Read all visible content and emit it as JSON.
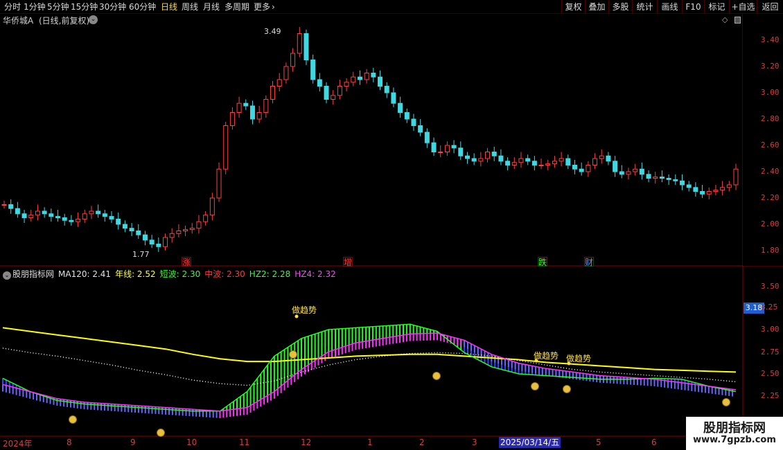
{
  "toolbar": {
    "periods": [
      "分时",
      "1分钟",
      "5分钟",
      "15分钟",
      "30分钟",
      "60分钟",
      "日线",
      "周线",
      "月线",
      "多周期",
      "更多"
    ],
    "active_period": "日线",
    "more_icon": "chevron-right-icon",
    "buttons": [
      "复权",
      "叠加",
      "多股",
      "统计",
      "画线",
      "F10",
      "标记",
      "+自选",
      "返回"
    ]
  },
  "stock": {
    "name": "华侨城A",
    "mode": "(日线,前复权)",
    "collapse_icon": "chevron-down-icon",
    "high_label": "3.49",
    "low_label": "1.77",
    "price_axis": [
      "3.40",
      "3.20",
      "3.00",
      "2.80",
      "2.60",
      "2.40",
      "2.20",
      "2.00",
      "1.80"
    ],
    "signal_labels": [
      {
        "text": "涨",
        "color": "#ff3b3b"
      },
      {
        "text": "增",
        "color": "#ff3b3b"
      },
      {
        "text": "跌",
        "color": "#33ff33"
      },
      {
        "text": "财",
        "color": "#3aa0ff"
      }
    ]
  },
  "indicator": {
    "name": "股朋指标网",
    "values": [
      {
        "label": "MA120: 2.41",
        "color": "#e0e0e0"
      },
      {
        "label": "年线: 2.52",
        "color": "#ffff33"
      },
      {
        "label": "短波: 2.30",
        "color": "#33ff33"
      },
      {
        "label": "中波: 2.30",
        "color": "#ff3b3b"
      },
      {
        "label": "HZ2: 2.28",
        "color": "#33ff33"
      },
      {
        "label": "HZ4: 2.32",
        "color": "#ff44ff"
      }
    ],
    "axis": [
      "3.50",
      "3.25",
      "3.00",
      "2.75",
      "2.50",
      "2.25"
    ],
    "current_value": "3.18",
    "annotations": [
      "做趋势",
      "做趋势",
      "做趋势"
    ],
    "colors": {
      "yearline": "#ffff00",
      "ma120": "#ffffff",
      "short_up": "#22ff22",
      "mid_up": "#ff33ff",
      "short_down": "#3344ff",
      "mid_down": "#cc44ff"
    }
  },
  "dates": {
    "labels": [
      "2024年",
      "8",
      "9",
      "10",
      "11",
      "12",
      "1",
      "2",
      "3",
      "5",
      "6"
    ],
    "selected": "2025/03/14/五"
  },
  "watermark": {
    "title": "股朋指标网",
    "url": "www.7gpzb.com"
  },
  "chart_data": {
    "type": "candlestick",
    "title": "华侨城A (日线,前复权)",
    "ylim": [
      1.72,
      3.55
    ],
    "price_ticks": [
      3.4,
      3.2,
      3.0,
      2.8,
      2.6,
      2.4,
      2.2,
      2.0,
      1.8
    ],
    "high": 3.49,
    "low": 1.77,
    "close_series": [
      2.15,
      2.12,
      2.08,
      2.05,
      2.07,
      2.1,
      2.08,
      2.06,
      2.05,
      2.03,
      2.02,
      2.04,
      2.08,
      2.1,
      2.08,
      2.06,
      2.04,
      2.0,
      1.97,
      1.95,
      1.92,
      1.88,
      1.85,
      1.83,
      1.9,
      1.93,
      1.95,
      1.96,
      1.97,
      2.02,
      2.07,
      2.2,
      2.42,
      2.75,
      2.85,
      2.92,
      2.9,
      2.8,
      2.85,
      2.95,
      3.05,
      3.1,
      3.2,
      3.3,
      3.45,
      3.25,
      3.1,
      3.05,
      2.95,
      2.98,
      3.05,
      3.08,
      3.12,
      3.1,
      3.15,
      3.12,
      3.05,
      3.0,
      2.92,
      2.85,
      2.8,
      2.75,
      2.7,
      2.62,
      2.55,
      2.55,
      2.6,
      2.58,
      2.52,
      2.5,
      2.48,
      2.5,
      2.55,
      2.52,
      2.48,
      2.45,
      2.47,
      2.5,
      2.48,
      2.45,
      2.45,
      2.46,
      2.48,
      2.5,
      2.45,
      2.42,
      2.4,
      2.45,
      2.5,
      2.52,
      2.48,
      2.4,
      2.38,
      2.4,
      2.42,
      2.38,
      2.35,
      2.36,
      2.35,
      2.34,
      2.33,
      2.3,
      2.28,
      2.25,
      2.23,
      2.25,
      2.26,
      2.28,
      2.3,
      2.42
    ],
    "indicator_series": {
      "year_line": [
        3.02,
        2.98,
        2.94,
        2.9,
        2.86,
        2.82,
        2.78,
        2.72,
        2.67,
        2.64,
        2.64,
        2.66,
        2.68,
        2.7,
        2.71,
        2.72,
        2.72,
        2.7,
        2.68,
        2.66,
        2.63,
        2.61,
        2.59,
        2.57,
        2.55,
        2.54,
        2.53,
        2.52
      ],
      "ma120": [
        2.79,
        2.74,
        2.7,
        2.65,
        2.6,
        2.54,
        2.49,
        2.43,
        2.39,
        2.37,
        2.42,
        2.52,
        2.6,
        2.66,
        2.7,
        2.73,
        2.74,
        2.73,
        2.7,
        2.65,
        2.6,
        2.55,
        2.52,
        2.5,
        2.48,
        2.46,
        2.44,
        2.41
      ],
      "short_wave": [
        2.45,
        2.3,
        2.2,
        2.16,
        2.14,
        2.12,
        2.1,
        2.08,
        2.08,
        2.3,
        2.7,
        2.9,
        3.0,
        3.02,
        3.04,
        3.06,
        2.98,
        2.74,
        2.58,
        2.5,
        2.48,
        2.46,
        2.44,
        2.44,
        2.45,
        2.44,
        2.36,
        2.3
      ],
      "mid_wave": [
        2.38,
        2.3,
        2.22,
        2.18,
        2.16,
        2.14,
        2.12,
        2.1,
        2.08,
        2.12,
        2.3,
        2.55,
        2.75,
        2.85,
        2.9,
        2.95,
        2.96,
        2.88,
        2.72,
        2.62,
        2.56,
        2.52,
        2.48,
        2.46,
        2.44,
        2.4,
        2.36,
        2.32
      ]
    }
  }
}
